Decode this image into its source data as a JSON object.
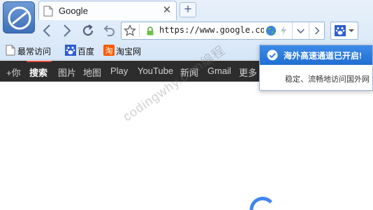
{
  "tab": {
    "title": "Google"
  },
  "address": {
    "url": "https://www.google.co"
  },
  "bookmarks": [
    {
      "label": "最常访问",
      "icon": "page-icon"
    },
    {
      "label": "百度",
      "icon": "baidu-paw-icon"
    },
    {
      "label": "淘宝网",
      "icon": "taobao-icon"
    }
  ],
  "gbar": {
    "items": [
      "+你",
      "搜索",
      "图片",
      "地图",
      "Play",
      "YouTube",
      "新闻",
      "Gmail",
      "更多"
    ],
    "active_index": 1
  },
  "popup": {
    "title": "海外高速通道已开启!",
    "body": "稳定、流畅地访问国外网"
  },
  "watermark": "codingwhy.com编程",
  "colors": {
    "chrome_bg": "#dbe8f7",
    "gbar_bg": "#2d2d2d",
    "popup_accent": "#2a7de1",
    "google_blue": "#4285f4"
  }
}
